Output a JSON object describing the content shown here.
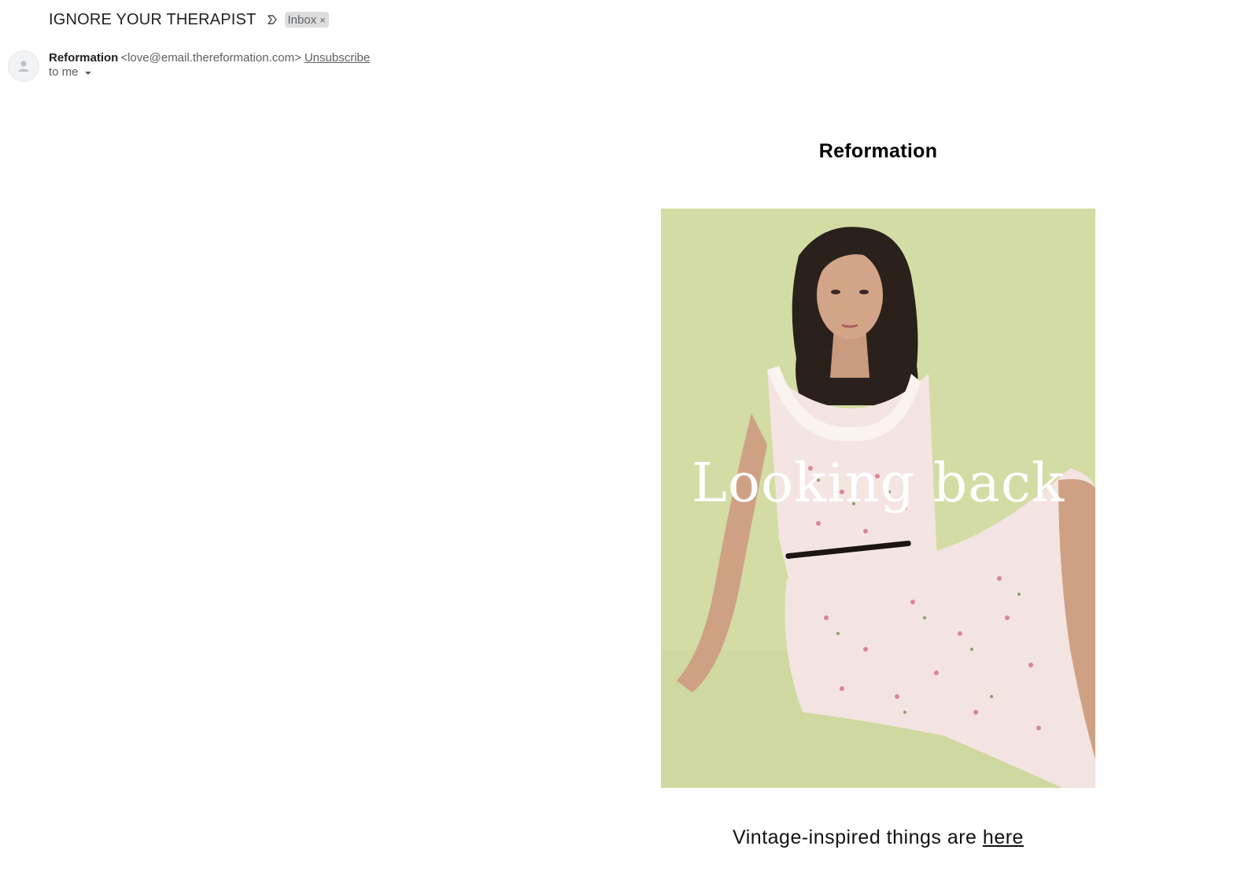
{
  "email": {
    "subject": "IGNORE YOUR THERAPIST",
    "label": "Inbox",
    "label_close": "×",
    "sender": {
      "name": "Reformation",
      "email": "<love@email.thereformation.com>",
      "unsubscribe": "Unsubscribe"
    },
    "recipient": "to me"
  },
  "body": {
    "brand": "Reformation",
    "hero_text": "Looking back",
    "tagline_prefix": "Vintage-inspired things are",
    "tagline_link": "here"
  },
  "colors": {
    "hero_background": "#d3dca4",
    "chip_background": "#dddddd"
  },
  "icons": {
    "importance": "importance-marker-icon",
    "avatar": "person-icon",
    "dropdown": "caret-down-icon"
  }
}
